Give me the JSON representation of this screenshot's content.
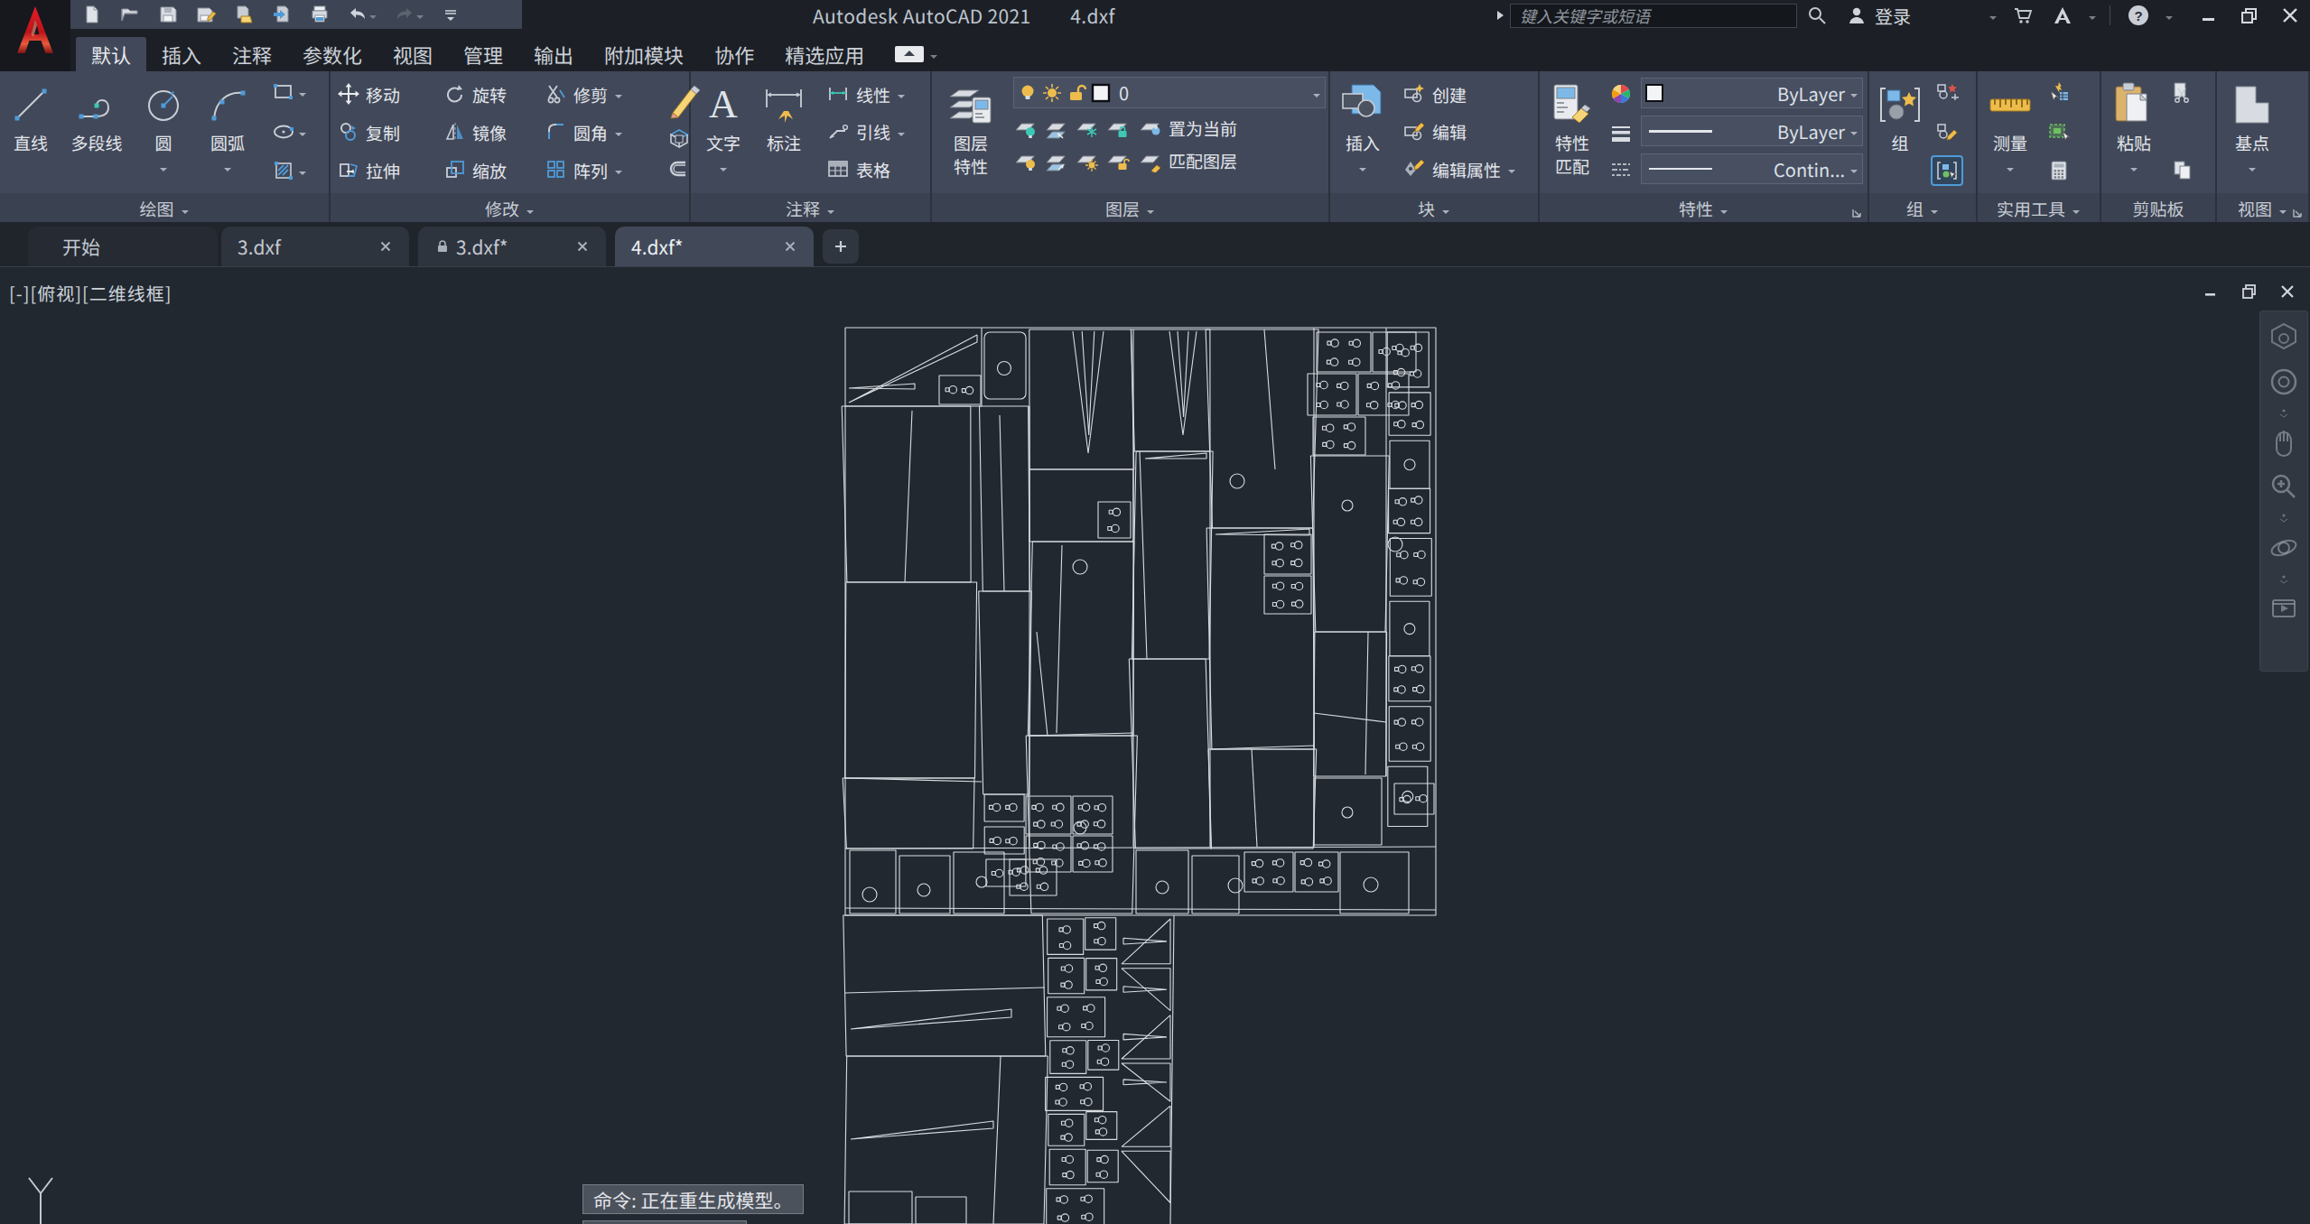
{
  "titlebar": {
    "app_title": "Autodesk AutoCAD 2021",
    "doc_title": "4.dxf",
    "search_placeholder": "键入关键字或短语",
    "signin_label": "登录"
  },
  "ribbon_tabs": {
    "items": [
      {
        "label": "默认",
        "active": true
      },
      {
        "label": "插入",
        "active": false
      },
      {
        "label": "注释",
        "active": false
      },
      {
        "label": "参数化",
        "active": false
      },
      {
        "label": "视图",
        "active": false
      },
      {
        "label": "管理",
        "active": false
      },
      {
        "label": "输出",
        "active": false
      },
      {
        "label": "附加模块",
        "active": false
      },
      {
        "label": "协作",
        "active": false
      },
      {
        "label": "精选应用",
        "active": false
      }
    ]
  },
  "draw_panel": {
    "label": "绘图",
    "line": "直线",
    "polyline": "多段线",
    "circle": "圆",
    "arc": "圆弧"
  },
  "modify_panel": {
    "label": "修改",
    "move": "移动",
    "rotate": "旋转",
    "trim": "修剪",
    "copy": "复制",
    "mirror": "镜像",
    "fillet": "圆角",
    "stretch": "拉伸",
    "scale": "缩放",
    "array": "阵列"
  },
  "annotate_panel": {
    "label": "注释",
    "text": "文字",
    "dimension": "标注",
    "linear": "线性",
    "leader": "引线",
    "table": "表格"
  },
  "layers_panel": {
    "label": "图层",
    "layer_properties_1": "图层",
    "layer_properties_2": "特性",
    "current_layer": "0",
    "set_current": "置为当前",
    "match_layer": "匹配图层"
  },
  "block_panel": {
    "label": "块",
    "insert": "插入",
    "create": "创建",
    "edit": "编辑",
    "edit_attrs": "编辑属性"
  },
  "properties_panel": {
    "label": "特性",
    "match_props_1": "特性",
    "match_props_2": "匹配",
    "color": "ByLayer",
    "lineweight": "ByLayer",
    "linetype": "Contin..."
  },
  "group_panel": {
    "label": "组",
    "group": "组"
  },
  "utilities_panel": {
    "label": "实用工具",
    "measure": "测量"
  },
  "clipboard_panel": {
    "label": "剪贴板",
    "paste": "粘贴"
  },
  "view_panel": {
    "label": "视图",
    "base_point": "基点"
  },
  "file_tabs": {
    "start_label": "开始",
    "tabs": [
      {
        "label": "3.dxf",
        "locked": false,
        "active": false
      },
      {
        "label": "3.dxf*",
        "locked": true,
        "active": false
      },
      {
        "label": "4.dxf*",
        "locked": false,
        "active": true
      }
    ]
  },
  "canvas": {
    "viewport_menu": "[-]",
    "viewport_view": "[俯视]",
    "viewport_style": "[二维线框]",
    "command_line": "命令: 正在重生成模型。",
    "command_line2": "正在重生成模型。"
  },
  "colors": {
    "accent_blue": "#4f9bd8",
    "accent_yellow": "#eebc4d",
    "canvas_bg": "#212830",
    "line": "#d4d8de",
    "ribbon_bg": "#3d4453"
  }
}
